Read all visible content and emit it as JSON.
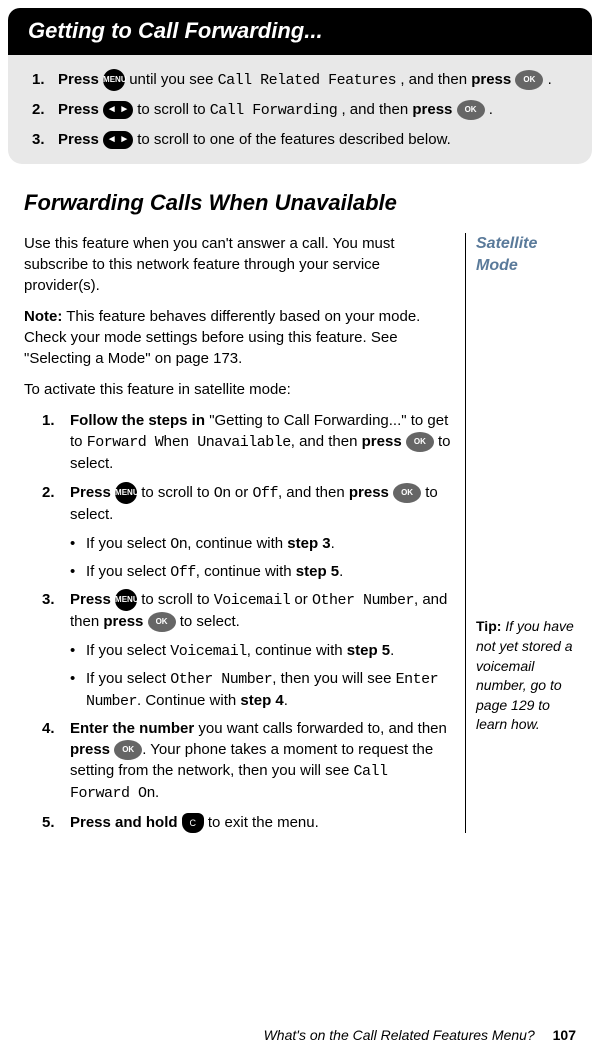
{
  "header": {
    "title": "Getting to Call Forwarding..."
  },
  "topSteps": [
    {
      "num": "1.",
      "prefix": "Press ",
      "middle": "until you see ",
      "lcd": "Call Related Features",
      "suffix": ", and then ",
      "bold2": "press ",
      "end": "."
    },
    {
      "num": "2.",
      "prefix": "Press ",
      "middle": "to scroll to ",
      "lcd": "Call Forwarding",
      "suffix": ", and then ",
      "bold2": "press ",
      "end": "."
    },
    {
      "num": "3.",
      "prefix": "Press ",
      "middle": "to scroll to one of the features described below.",
      "lcd": "",
      "suffix": "",
      "bold2": "",
      "end": ""
    }
  ],
  "sectionTitle": "Forwarding Calls When Unavailable",
  "intro": "Use this feature when you can't answer a call. You must subscribe to this network feature through your service provider(s).",
  "noteLabel": "Note:",
  "noteText": " This feature behaves differently based on your mode. Check your mode settings before using this feature. See \"Selecting a Mode\" on page 173.",
  "activateIntro": "To activate this feature in satellite mode:",
  "sideLabel": "Satellite Mode",
  "steps": {
    "s1": {
      "num": "1.",
      "bold": "Follow the steps in ",
      "text1": "\"Getting to Call Forwarding...\" to get to ",
      "lcd": "Forward When Unavailable",
      "text2": ", and then ",
      "bold2": "press ",
      "text3": " to select."
    },
    "s2": {
      "num": "2.",
      "bold": "Press ",
      "text1": " to scroll to ",
      "lcd1": "On",
      "or": " or ",
      "lcd2": "Off",
      "text2": ", and then ",
      "bold2": "press ",
      "text3": " to select."
    },
    "s2b1": {
      "text1": "If you select ",
      "lcd": "On",
      "text2": ", continue with ",
      "bold": "step 3",
      "text3": "."
    },
    "s2b2": {
      "text1": "If you select ",
      "lcd": "Off",
      "text2": ", continue with ",
      "bold": "step 5",
      "text3": "."
    },
    "s3": {
      "num": "3.",
      "bold": "Press ",
      "text1": " to scroll to ",
      "lcd1": "Voicemail",
      "or": " or ",
      "lcd2": "Other Number",
      "text2": ", and then ",
      "bold2": "press ",
      "text3": " to select."
    },
    "s3b1": {
      "text1": "If you select ",
      "lcd": "Voicemail",
      "text2": ", continue with ",
      "bold": "step 5",
      "text3": "."
    },
    "s3b2": {
      "text1": "If you select ",
      "lcd": "Other Number",
      "text2": ", then you will see ",
      "lcd2": "Enter Number",
      "text3": ". Continue with ",
      "bold": "step 4",
      "text4": "."
    },
    "s4": {
      "num": "4.",
      "bold": "Enter the number ",
      "text1": "you want calls forwarded to, and then ",
      "bold2": "press ",
      "text2": ". Your phone takes a moment to request the setting from the network, then you will see ",
      "lcd": "Call Forward On",
      "text3": "."
    },
    "s5": {
      "num": "5.",
      "bold": "Press and hold ",
      "text1": " to exit the menu."
    }
  },
  "tipLabel": "Tip:",
  "tipText": " If you have not yet stored a voicemail number, go to page 129 to learn how.",
  "footerText": "What's on the Call Related Features Menu?",
  "pageNum": "107",
  "icons": {
    "menu": "MENU",
    "ok": "OK",
    "arrow": "◄ ►",
    "c": "C"
  }
}
